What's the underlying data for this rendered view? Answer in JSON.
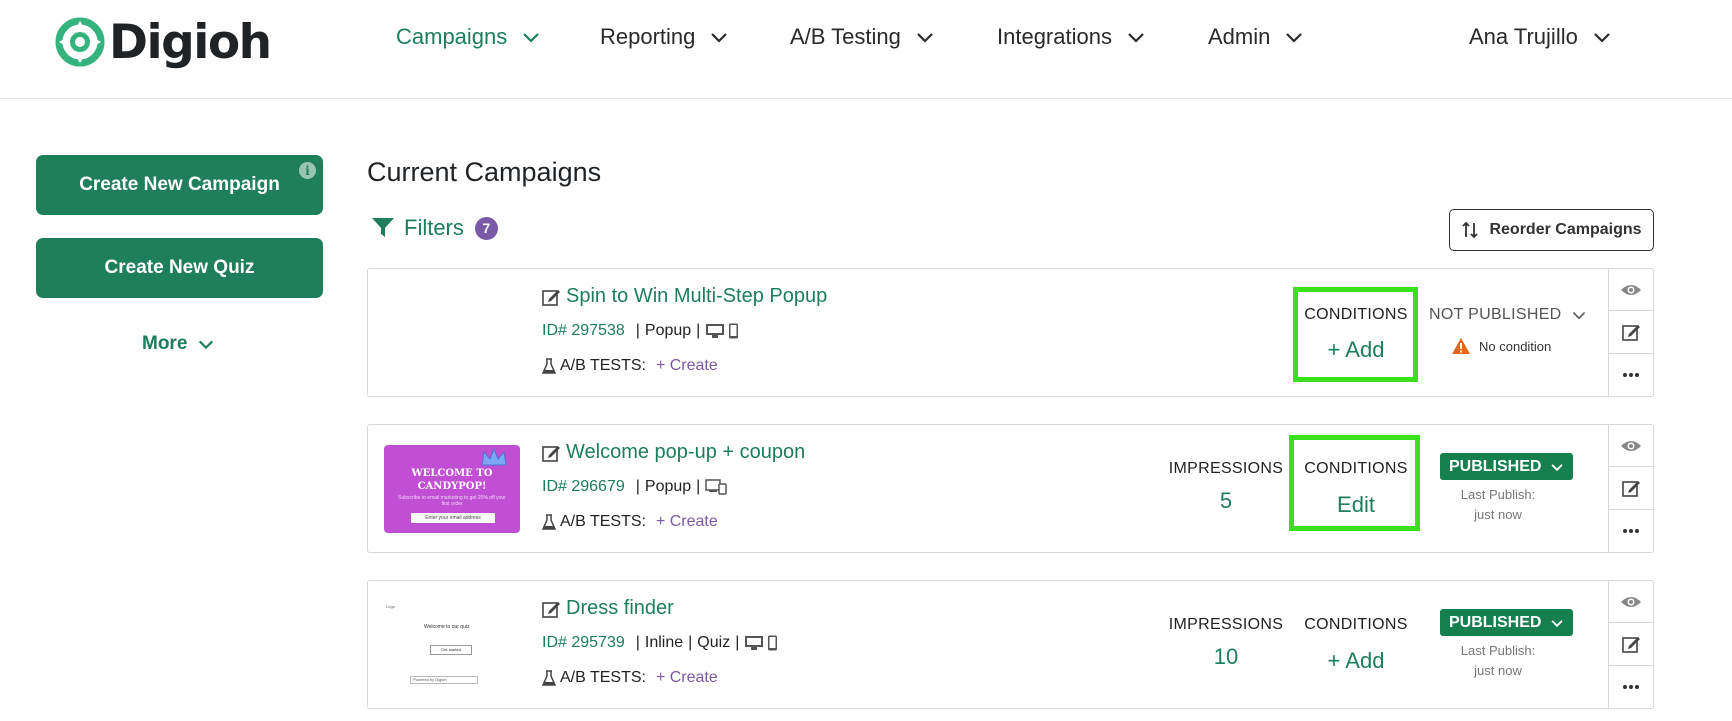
{
  "brand": {
    "name": "Digioh",
    "primary": "#1f7f5a",
    "accent_text": "#1c7e5b",
    "highlight": "#3ae01c",
    "badge_purple": "#7a5aa6"
  },
  "nav": {
    "campaigns": "Campaigns",
    "reporting": "Reporting",
    "ab_testing": "A/B Testing",
    "integrations": "Integrations",
    "admin": "Admin",
    "user": "Ana Trujillo"
  },
  "sidebar": {
    "create_campaign": "Create New Campaign",
    "info_glyph": "i",
    "create_quiz": "Create New Quiz",
    "more": "More"
  },
  "main": {
    "title": "Current Campaigns",
    "filters_label": "Filters",
    "filters_count": "7",
    "reorder_label": "Reorder Campaigns"
  },
  "campaigns": [
    {
      "name": "Spin to Win Multi-Step Popup",
      "id": "ID# 297538",
      "type": "Popup",
      "devices": [
        "desktop-icon",
        "mobile-icon"
      ],
      "ab_label": "A/B TESTS:",
      "ab_action": "+ Create",
      "conditions_label": "CONDITIONS",
      "conditions_value": "+ Add",
      "status": "NOT PUBLISHED",
      "status_note": "No condition"
    },
    {
      "name": "Welcome pop-up + coupon",
      "id": "ID# 296679",
      "type": "Popup",
      "devices": [
        "desktop-mobile-icon"
      ],
      "ab_label": "A/B TESTS:",
      "ab_action": "+ Create",
      "impressions_label": "IMPRESSIONS",
      "impressions_value": "5",
      "conditions_label": "CONDITIONS",
      "conditions_value": "Edit",
      "status": "PUBLISHED",
      "last_publish_label": "Last Publish:",
      "last_publish_value": "just now",
      "thumbnail": {
        "title_line1": "WELCOME TO",
        "title_line2": "CANDYPOP!",
        "subtitle": "Subscribe to email marketing to get 20% off your first order",
        "input_placeholder": "Enter your email address"
      }
    },
    {
      "name": "Dress finder",
      "id": "ID# 295739",
      "type": "Inline",
      "subtype": "Quiz",
      "devices": [
        "desktop-icon",
        "mobile-icon"
      ],
      "ab_label": "A/B TESTS:",
      "ab_action": "+ Create",
      "impressions_label": "IMPRESSIONS",
      "impressions_value": "10",
      "conditions_label": "CONDITIONS",
      "conditions_value": "+ Add",
      "status": "PUBLISHED",
      "last_publish_label": "Last Publish:",
      "last_publish_value": "just now",
      "thumbnail": {
        "logo": "Logo",
        "title": "Welcome to our quiz",
        "button": "Get started",
        "footer": "Powered by Digioh"
      }
    }
  ]
}
